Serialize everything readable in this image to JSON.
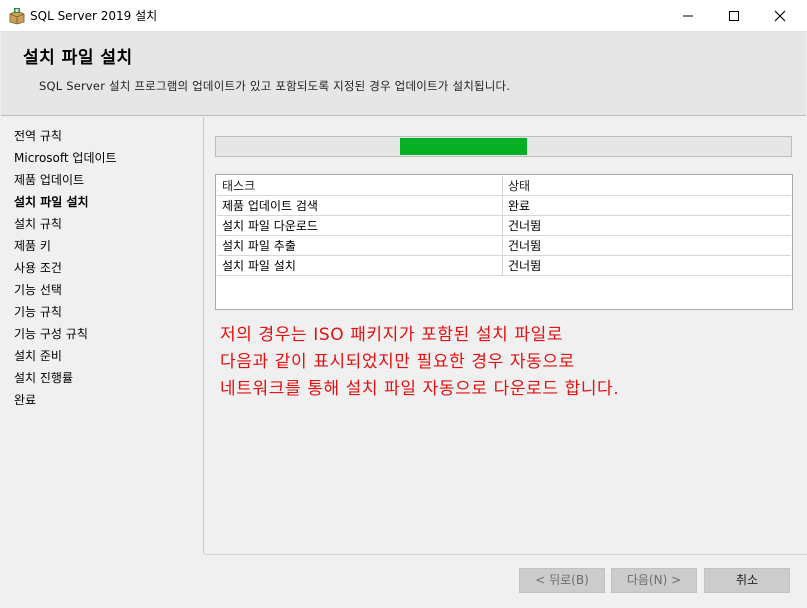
{
  "window": {
    "title": "SQL Server 2019 설치",
    "controls": [
      "minimize-icon",
      "maximize-icon",
      "close-icon"
    ]
  },
  "header": {
    "title": "설치 파일 설치",
    "subtitle": "SQL Server 설치 프로그램의 업데이트가 있고 포함되도록 지정된 경우 업데이트가 설치됩니다."
  },
  "sidebar": {
    "items": [
      {
        "label": "전역 규칙"
      },
      {
        "label": "Microsoft 업데이트"
      },
      {
        "label": "제품 업데이트"
      },
      {
        "label": "설치 파일 설치",
        "active": true
      },
      {
        "label": "설치 규칙"
      },
      {
        "label": "제품 키"
      },
      {
        "label": "사용 조건"
      },
      {
        "label": "기능 선택"
      },
      {
        "label": "기능 규칙"
      },
      {
        "label": "기능 구성 규칙"
      },
      {
        "label": "설치 준비"
      },
      {
        "label": "설치 진행률"
      },
      {
        "label": "완료"
      }
    ]
  },
  "progress": {
    "bar_color": "#06b025"
  },
  "tasks": {
    "headers": {
      "task": "태스크",
      "status": "상태"
    },
    "rows": [
      {
        "task": "제품 업데이트 검색",
        "status": "완료"
      },
      {
        "task": "설치 파일 다운로드",
        "status": "건너뜀"
      },
      {
        "task": "설치 파일 추출",
        "status": "건너뜀"
      },
      {
        "task": "설치 파일 설치",
        "status": "건너뜀"
      }
    ]
  },
  "annotation": {
    "lines": [
      "저의 경우는 ISO 패키지가 포함된 설치 파일로",
      "다음과 같이 표시되었지만 필요한 경우 자동으로",
      "네트워크를 통해 설치 파일 자동으로 다운로드 합니다."
    ],
    "color": "#e21010"
  },
  "footer": {
    "back_label": "< 뒤로(B)",
    "next_label": "다음(N) >",
    "cancel_label": "취소"
  }
}
